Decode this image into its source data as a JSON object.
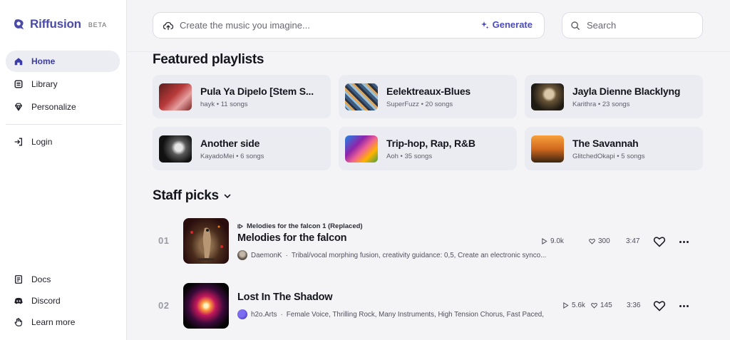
{
  "brand": {
    "name": "Riffusion",
    "badge": "BETA"
  },
  "sidebar": {
    "primary": [
      {
        "label": "Home",
        "icon": "home-icon",
        "active": true
      },
      {
        "label": "Library",
        "icon": "library-icon",
        "active": false
      },
      {
        "label": "Personalize",
        "icon": "gem-icon",
        "active": false
      }
    ],
    "login": {
      "label": "Login",
      "icon": "login-icon"
    },
    "footer": [
      {
        "label": "Docs",
        "icon": "docs-icon"
      },
      {
        "label": "Discord",
        "icon": "discord-icon"
      },
      {
        "label": "Learn more",
        "icon": "hand-icon"
      }
    ]
  },
  "topbar": {
    "prompt_placeholder": "Create the music you imagine...",
    "generate_label": "Generate",
    "search_placeholder": "Search"
  },
  "featured": {
    "title": "Featured playlists",
    "playlists": [
      {
        "title": "Pula Ya Dipelo [Stem S...",
        "author": "hayk",
        "songs": "11 songs"
      },
      {
        "title": "Eelektreaux-Blues",
        "author": "SuperFuzz",
        "songs": "20 songs"
      },
      {
        "title": "Jayla Dienne Blacklyng",
        "author": "Karithra",
        "songs": "23 songs"
      },
      {
        "title": "Another side",
        "author": "KayadoMei",
        "songs": "6 songs"
      },
      {
        "title": "Trip-hop, Rap, R&B",
        "author": "Aoh",
        "songs": "35 songs"
      },
      {
        "title": "The Savannah",
        "author": "GlitchedOkapi",
        "songs": "5 songs"
      }
    ]
  },
  "staff": {
    "title": "Staff picks",
    "tracks": [
      {
        "num": "01",
        "remix_of": "Melodies for the falcon 1 (Replaced)",
        "title": "Melodies for the falcon",
        "author": "DaemonK",
        "desc": "Tribal/vocal morphing fusion, creativity guidance: 0,5, Create an electronic synco...",
        "plays": "9.0k",
        "likes": "300",
        "duration": "3:47"
      },
      {
        "num": "02",
        "remix_of": "",
        "title": "Lost In The Shadow",
        "author": "h2o.Arts",
        "desc": "Female Voice, Thrilling Rock, Many Instruments, High Tension Chorus, Fast Paced,",
        "plays": "5.6k",
        "likes": "145",
        "duration": "3:36"
      }
    ]
  },
  "colors": {
    "accent": "#4b4bc0",
    "background": "#f4f4f7",
    "card": "#ebebf2"
  }
}
